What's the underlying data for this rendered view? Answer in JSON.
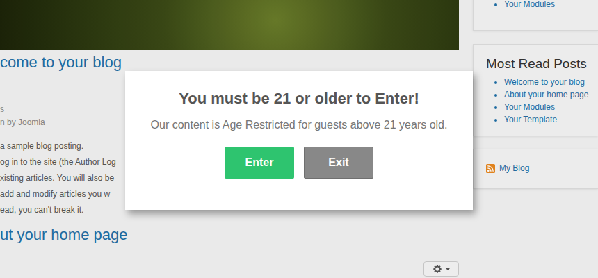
{
  "article": {
    "title": "come to your blog",
    "meta": [
      "s",
      "n by Joomla"
    ],
    "paragraphs": [
      "a sample blog posting.",
      "og in to the site (the Author Log",
      "xisting articles. You will also be",
      "add and modify articles you w",
      "ead, you can't break it."
    ]
  },
  "next_article": {
    "title": "ut your home page"
  },
  "sidebar": {
    "top_items": [
      "Your Modules"
    ],
    "most_read": {
      "title": "Most Read Posts",
      "items": [
        "Welcome to your blog",
        "About your home page",
        "Your Modules",
        "Your Template"
      ]
    },
    "feed": {
      "label": "My Blog"
    }
  },
  "modal": {
    "title": "You must be 21 or older to Enter!",
    "message": "Our content is Age Restricted for guests above 21 years old.",
    "buttons": [
      {
        "label": "Enter",
        "kind": "primary"
      },
      {
        "label": "Exit",
        "kind": "secondary"
      }
    ]
  }
}
